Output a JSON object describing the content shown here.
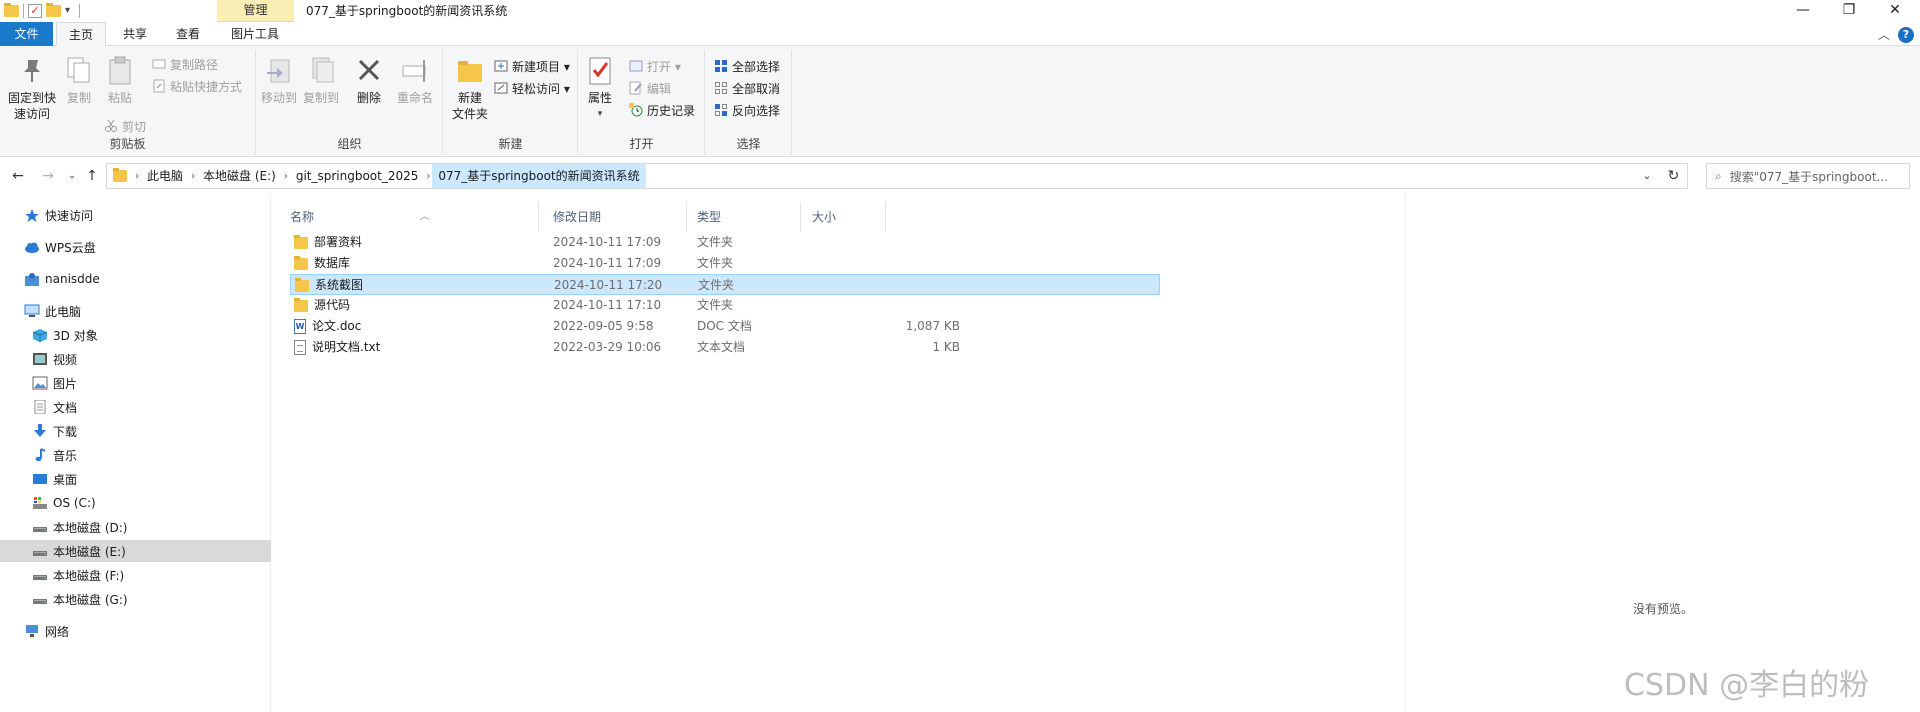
{
  "title_bar": {
    "context_tab": "管理",
    "window_title": "077_基于springboot的新闻资讯系统",
    "minimize": "—",
    "restore": "❐",
    "close": "✕"
  },
  "tabs": {
    "file": "文件",
    "home": "主页",
    "share": "共享",
    "view": "查看",
    "picture_tools": "图片工具"
  },
  "ribbon": {
    "clipboard": {
      "label": "剪贴板",
      "pin": "固定到快\n速访问",
      "copy": "复制",
      "paste": "粘贴",
      "copy_path": "复制路径",
      "paste_shortcut": "粘贴快捷方式",
      "cut": "剪切"
    },
    "organize": {
      "label": "组织",
      "move_to": "移动到",
      "copy_to": "复制到",
      "delete": "删除",
      "rename": "重命名"
    },
    "new": {
      "label": "新建",
      "new_item": "新建项目 ▾",
      "easy_access": "轻松访问 ▾",
      "new_folder": "新建\n文件夹"
    },
    "open": {
      "label": "打开",
      "properties": "属性",
      "open": "打开 ▾",
      "edit": "编辑",
      "history": "历史记录"
    },
    "select": {
      "label": "选择",
      "select_all": "全部选择",
      "select_none": "全部取消",
      "invert": "反向选择"
    }
  },
  "address_bar": {
    "crumbs": [
      "此电脑",
      "本地磁盘 (E:)",
      "git_springboot_2025",
      "077_基于springboot的新闻资讯系统"
    ],
    "search_placeholder": "搜索\"077_基于springboot..."
  },
  "sidebar": {
    "items": [
      {
        "label": "快速访问",
        "icon": "star-icon"
      },
      {
        "label": "WPS云盘",
        "icon": "cloud-icon"
      },
      {
        "label": "nanisdde",
        "icon": "user-folder-icon"
      },
      {
        "label": "此电脑",
        "icon": "computer-icon"
      },
      {
        "label": "3D 对象",
        "icon": "cube-icon"
      },
      {
        "label": "视频",
        "icon": "video-icon"
      },
      {
        "label": "图片",
        "icon": "picture-icon"
      },
      {
        "label": "文档",
        "icon": "document-icon"
      },
      {
        "label": "下载",
        "icon": "download-icon"
      },
      {
        "label": "音乐",
        "icon": "music-icon"
      },
      {
        "label": "桌面",
        "icon": "desktop-icon"
      },
      {
        "label": "OS (C:)",
        "icon": "os-drive-icon"
      },
      {
        "label": "本地磁盘 (D:)",
        "icon": "drive-icon"
      },
      {
        "label": "本地磁盘 (E:)",
        "icon": "drive-icon"
      },
      {
        "label": "本地磁盘 (F:)",
        "icon": "drive-icon"
      },
      {
        "label": "本地磁盘 (G:)",
        "icon": "drive-icon"
      },
      {
        "label": "网络",
        "icon": "network-icon"
      }
    ]
  },
  "columns": {
    "name": "名称",
    "date": "修改日期",
    "type": "类型",
    "size": "大小"
  },
  "files": [
    {
      "name": "部署资料",
      "date": "2024-10-11 17:09",
      "type": "文件夹",
      "size": "",
      "icon": "folder-icon"
    },
    {
      "name": "数据库",
      "date": "2024-10-11 17:09",
      "type": "文件夹",
      "size": "",
      "icon": "folder-icon"
    },
    {
      "name": "系统截图",
      "date": "2024-10-11 17:20",
      "type": "文件夹",
      "size": "",
      "icon": "folder-icon"
    },
    {
      "name": "源代码",
      "date": "2024-10-11 17:10",
      "type": "文件夹",
      "size": "",
      "icon": "folder-icon"
    },
    {
      "name": "论文.doc",
      "date": "2022-09-05 9:58",
      "type": "DOC 文档",
      "size": "1,087 KB",
      "icon": "doc-file-icon"
    },
    {
      "name": "说明文档.txt",
      "date": "2022-03-29 10:06",
      "type": "文本文档",
      "size": "1 KB",
      "icon": "txt-file-icon"
    }
  ],
  "preview": {
    "empty_text": "没有预览。"
  },
  "watermark": "CSDN @李白的粉",
  "colors": {
    "accent": "#1979ca",
    "selection": "#cce8ff",
    "folder": "#f5c64a"
  }
}
